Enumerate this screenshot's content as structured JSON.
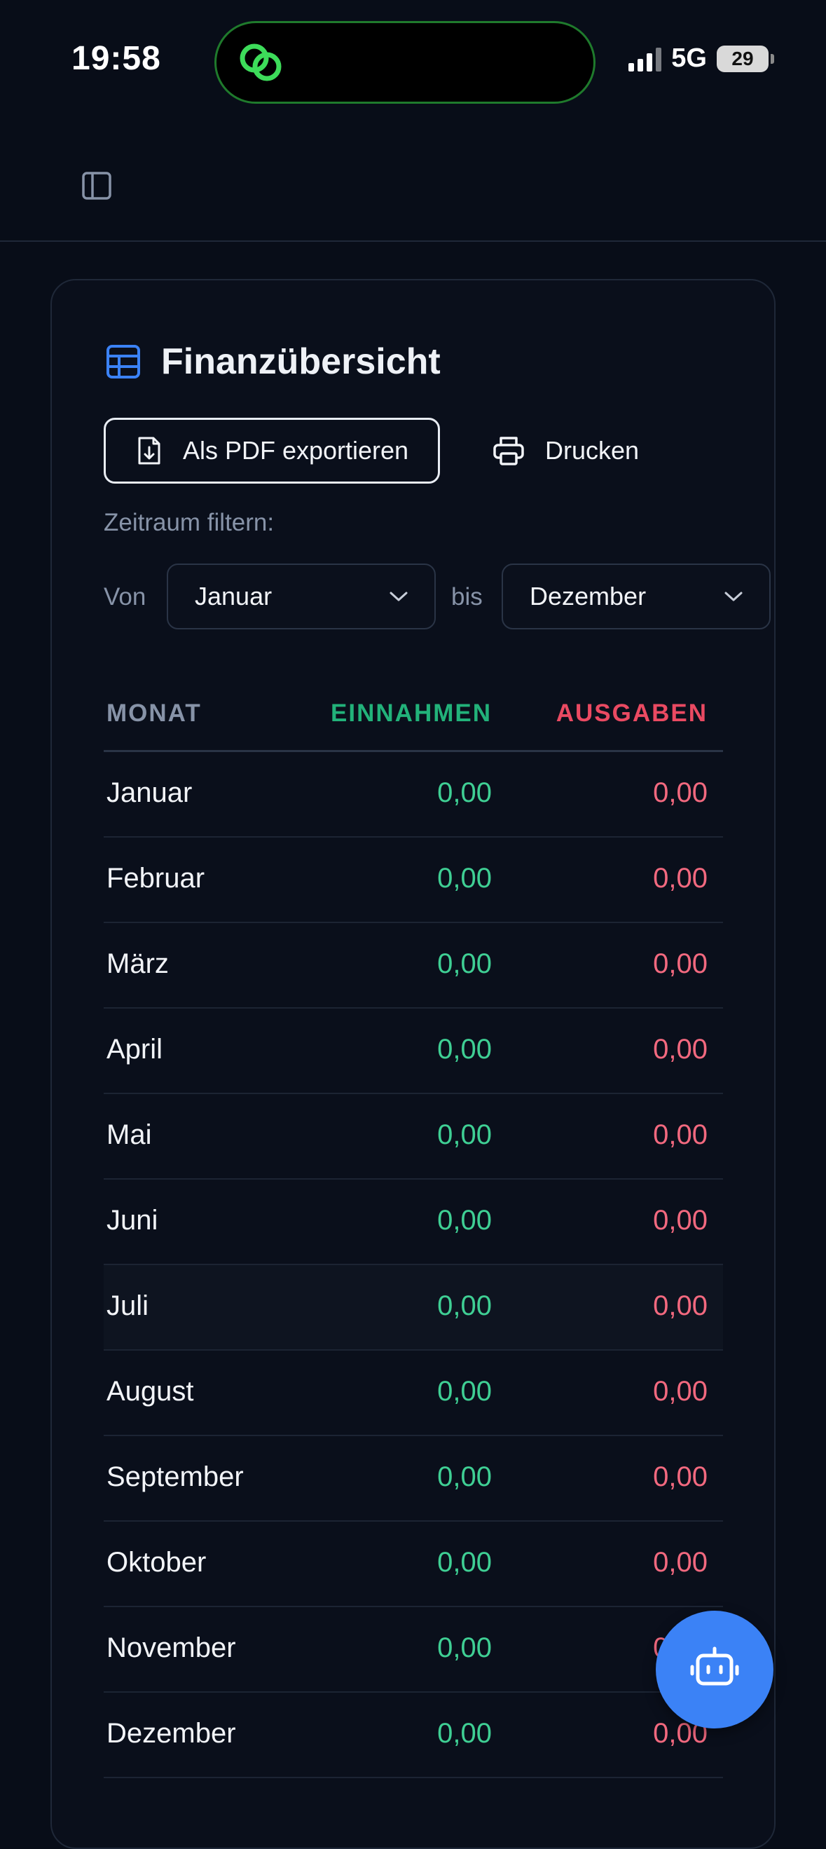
{
  "status_bar": {
    "time": "19:58",
    "network": "5G",
    "battery": "29"
  },
  "card": {
    "title": "Finanzübersicht",
    "export_label": "Als PDF exportieren",
    "print_label": "Drucken",
    "filter_label": "Zeitraum filtern:",
    "from_label": "Von",
    "from_value": "Januar",
    "to_label": "bis",
    "to_value": "Dezember"
  },
  "table": {
    "headers": {
      "month": "MONAT",
      "income": "EINNAHMEN",
      "expense": "AUSGABEN"
    },
    "rows": [
      {
        "month": "Januar",
        "income": "0,00",
        "expense": "0,00"
      },
      {
        "month": "Februar",
        "income": "0,00",
        "expense": "0,00"
      },
      {
        "month": "März",
        "income": "0,00",
        "expense": "0,00"
      },
      {
        "month": "April",
        "income": "0,00",
        "expense": "0,00"
      },
      {
        "month": "Mai",
        "income": "0,00",
        "expense": "0,00"
      },
      {
        "month": "Juni",
        "income": "0,00",
        "expense": "0,00"
      },
      {
        "month": "Juli",
        "income": "0,00",
        "expense": "0,00"
      },
      {
        "month": "August",
        "income": "0,00",
        "expense": "0,00"
      },
      {
        "month": "September",
        "income": "0,00",
        "expense": "0,00"
      },
      {
        "month": "Oktober",
        "income": "0,00",
        "expense": "0,00"
      },
      {
        "month": "November",
        "income": "0,00",
        "expense": "0,00"
      },
      {
        "month": "Dezember",
        "income": "0,00",
        "expense": "0,00"
      }
    ]
  },
  "colors": {
    "accent": "#3b82f6",
    "income": "#22b27a",
    "expense": "#ea4a62",
    "background": "#080d18"
  },
  "icons": {
    "sidebar": "sidebar-toggle-icon",
    "table": "table-icon",
    "export": "file-download-icon",
    "print": "printer-icon",
    "assistant": "robot-icon"
  }
}
